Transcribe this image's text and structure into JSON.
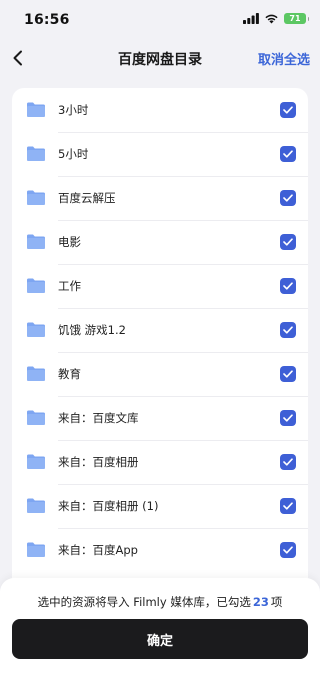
{
  "status_bar": {
    "time": "16:56",
    "battery": "71",
    "signal_icon": "cellular-signal-icon",
    "wifi_icon": "wifi-icon"
  },
  "nav": {
    "back_icon": "chevron-left-icon",
    "title": "百度网盘目录",
    "action": "取消全选"
  },
  "folders": [
    {
      "label": "3小时",
      "checked": true
    },
    {
      "label": "5小时",
      "checked": true
    },
    {
      "label": "百度云解压",
      "checked": true
    },
    {
      "label": "电影",
      "checked": true
    },
    {
      "label": "工作",
      "checked": true
    },
    {
      "label": "饥饿 游戏1.2",
      "checked": true
    },
    {
      "label": "教育",
      "checked": true
    },
    {
      "label": "来自：百度文库",
      "checked": true
    },
    {
      "label": "来自：百度相册",
      "checked": true
    },
    {
      "label": "来自：百度相册 (1)",
      "checked": true
    },
    {
      "label": "来自：百度App",
      "checked": true
    }
  ],
  "footer": {
    "note_prefix": "选中的资源将导入 Filmly 媒体库，已勾选",
    "selected_count": "23",
    "note_suffix": "项",
    "confirm_label": "确定"
  },
  "colors": {
    "accent": "#3c66d8",
    "checkbox": "#3e5fd6",
    "folder": "#8fb3f5",
    "button": "#1b1b1d",
    "battery": "#5cc763"
  }
}
